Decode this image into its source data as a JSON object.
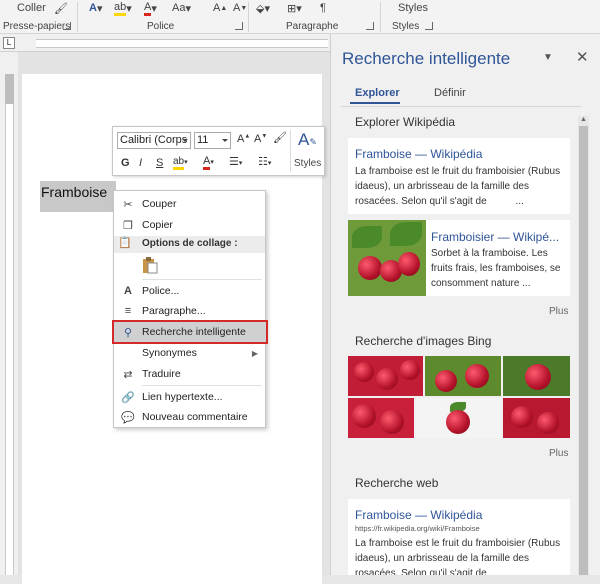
{
  "ribbon": {
    "top_labels": [
      "Coller",
      "Aa",
      "Styles"
    ],
    "groups": [
      "Presse-papiers",
      "Police",
      "Paragraphe",
      "Styles"
    ],
    "paragraph_mark": "¶"
  },
  "document": {
    "selected_word": "Framboise",
    "ruler_corner": "L"
  },
  "mini_toolbar": {
    "font_name": "Calibri (Corps",
    "font_size": "11",
    "bold": "G",
    "italic": "I",
    "underline": "S",
    "grow": "A",
    "shrink": "A",
    "styles_label": "Styles"
  },
  "context_menu": {
    "cut": "Couper",
    "copy": "Copier",
    "paste_header": "Options de collage :",
    "font": "Police...",
    "paragraph": "Paragraphe...",
    "smart_lookup": "Recherche intelligente",
    "synonyms": "Synonymes",
    "translate": "Traduire",
    "hyperlink": "Lien hypertexte...",
    "new_comment": "Nouveau commentaire"
  },
  "pane": {
    "title": "Recherche intelligente",
    "tabs": [
      "Explorer",
      "Définir"
    ],
    "wiki_section": "Explorer Wikipédia",
    "wiki_card1": {
      "title": "Framboise — Wikipédia",
      "text": "La framboise est le fruit du framboisier (Rubus idaeus), un arbrisseau de la famille des rosacées. Selon qu'il s'agit de",
      "ellipsis": "..."
    },
    "wiki_card2": {
      "title": "Framboisier — Wikipé...",
      "text": "Sorbet à la framboise. Les fruits frais, les framboises, se consomment nature ..."
    },
    "more1": "Plus",
    "bing_section": "Recherche d'images Bing",
    "more2": "Plus",
    "web_section": "Recherche web",
    "web_card": {
      "title": "Framboise — Wikipédia",
      "url": "https://fr.wikipedia.org/wiki/Framboise",
      "text": "La framboise est le fruit du framboisier (Rubus idaeus), un arbrisseau de la famille des rosacées. Selon qu'il s'agit de"
    }
  },
  "colors": {
    "accent": "#2f5597",
    "highlight_border": "#d42a2a",
    "font_color_red": "#d9261c",
    "highlight_yellow": "#ffd700"
  }
}
